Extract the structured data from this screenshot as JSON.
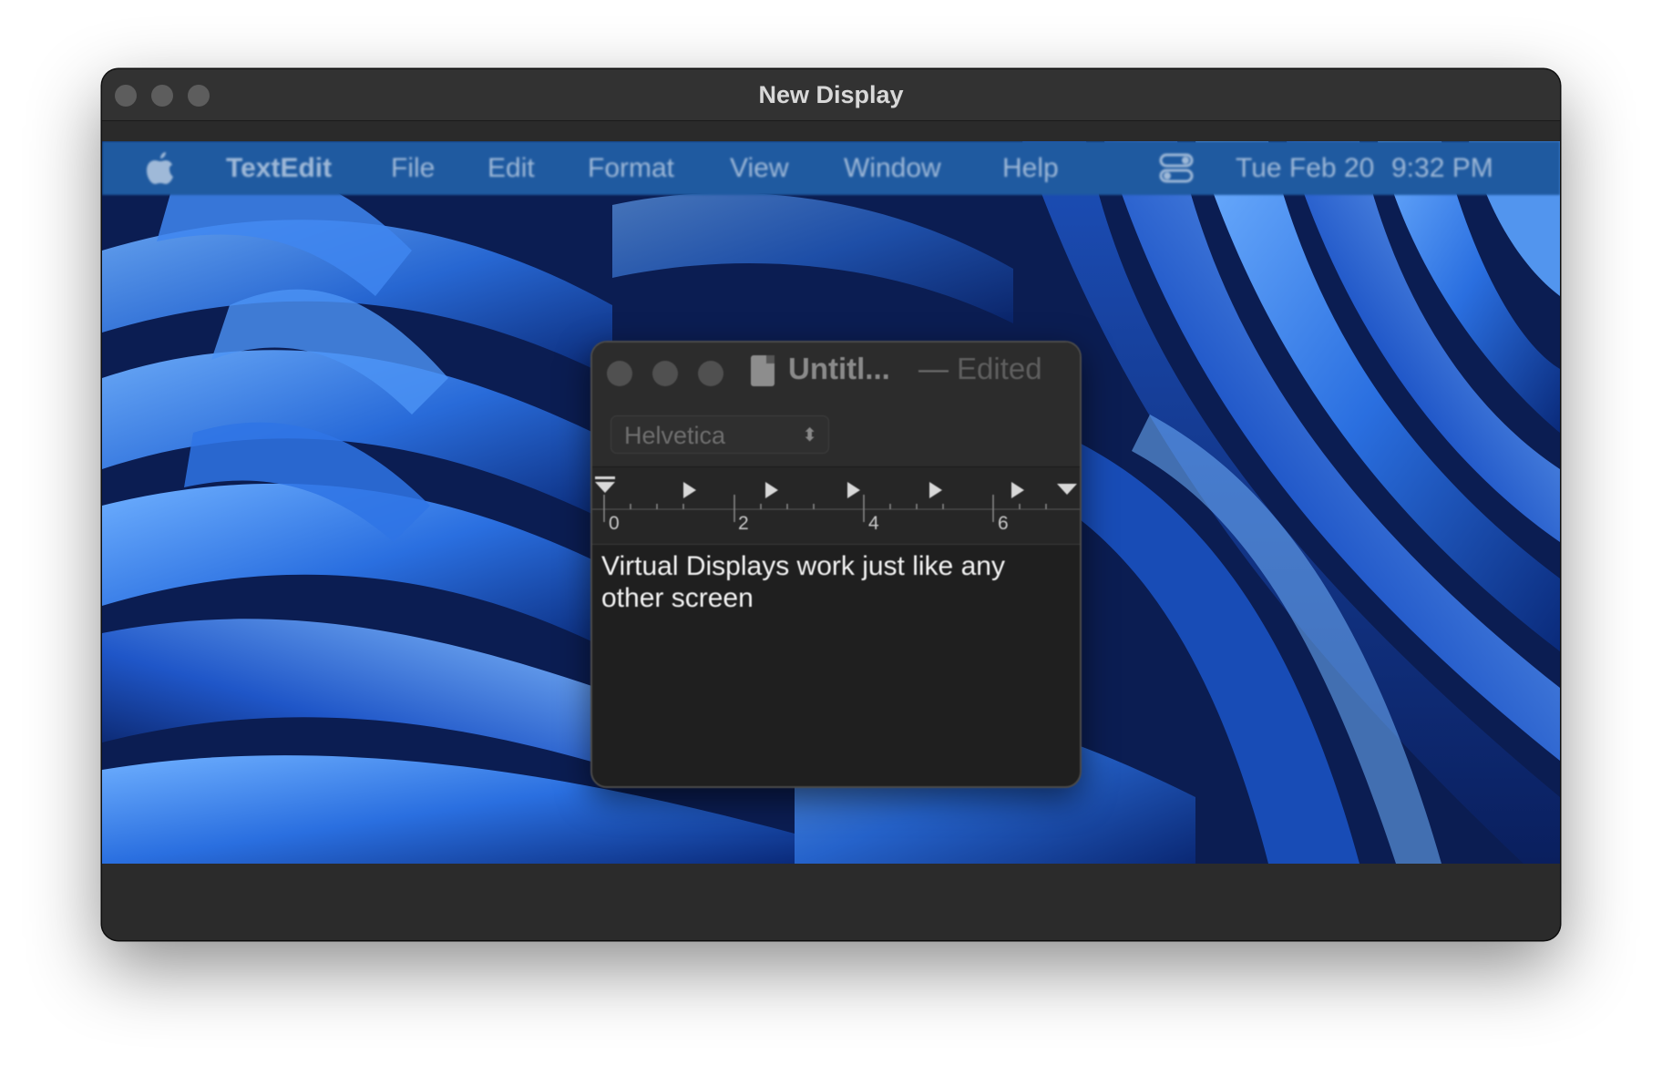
{
  "outer_window": {
    "title": "New Display"
  },
  "menubar": {
    "apple_icon": "apple-logo-icon",
    "app_name": "TextEdit",
    "items": [
      "File",
      "Edit",
      "Format",
      "View",
      "Window",
      "Help"
    ],
    "control_center_icon": "control-center-icon",
    "date": "Tue Feb 20",
    "time": "9:32 PM"
  },
  "textedit": {
    "title": "Untitl...",
    "separator": "—",
    "status": "Edited",
    "font": "Helvetica",
    "ruler_labels": [
      "0",
      "2",
      "4",
      "6"
    ],
    "content": "Virtual Displays work just like any other screen"
  },
  "colors": {
    "menubar_bg": "#1f5aa0",
    "window_chrome": "#323232",
    "wallpaper_blue": "#1a5fd8"
  }
}
